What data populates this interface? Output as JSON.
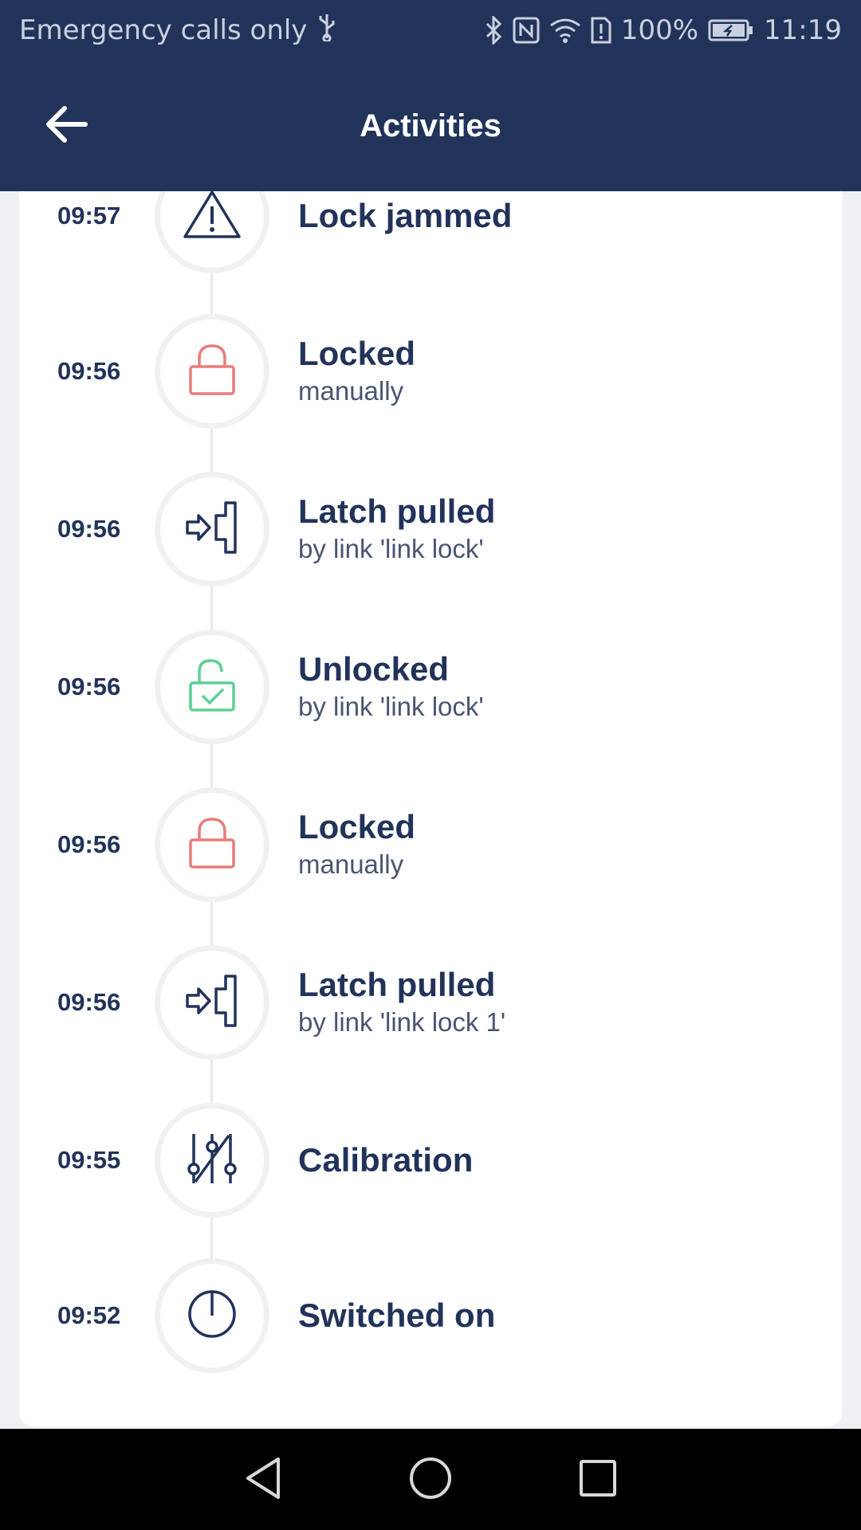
{
  "status_bar": {
    "carrier": "Emergency calls only",
    "battery": "100%",
    "time": "11:19"
  },
  "app_bar": {
    "title": "Activities",
    "back_icon": "arrow-left-icon"
  },
  "activities": [
    {
      "time": "09:57",
      "title": "Lock jammed",
      "subtitle": "",
      "icon": "warning-triangle-icon"
    },
    {
      "time": "09:56",
      "title": "Locked",
      "subtitle": "manually",
      "icon": "lock-icon"
    },
    {
      "time": "09:56",
      "title": "Latch pulled",
      "subtitle": "by link 'link lock'",
      "icon": "latch-icon"
    },
    {
      "time": "09:56",
      "title": "Unlocked",
      "subtitle": "by link 'link lock'",
      "icon": "unlock-check-icon"
    },
    {
      "time": "09:56",
      "title": "Locked",
      "subtitle": "manually",
      "icon": "lock-icon"
    },
    {
      "time": "09:56",
      "title": "Latch pulled",
      "subtitle": "by link 'link lock 1'",
      "icon": "latch-icon"
    },
    {
      "time": "09:55",
      "title": "Calibration",
      "subtitle": "",
      "icon": "calibration-sliders-icon"
    },
    {
      "time": "09:52",
      "title": "Switched on",
      "subtitle": "",
      "icon": "power-icon"
    }
  ],
  "colors": {
    "header": "#22335a",
    "text_primary": "#22335a",
    "locked_red": "#e87c7c",
    "unlocked_green": "#5fcf94"
  }
}
